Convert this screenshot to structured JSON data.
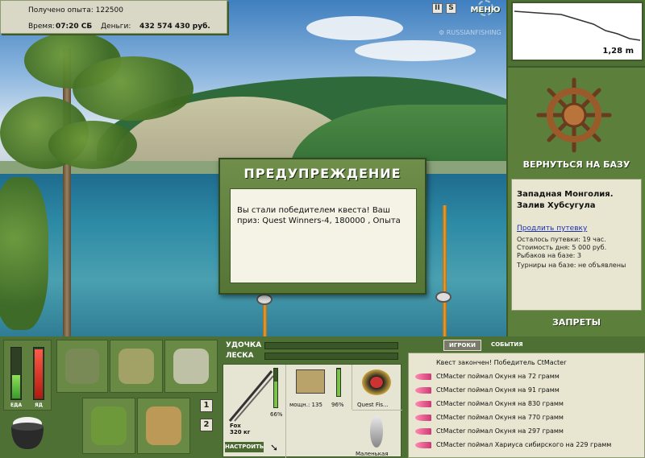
{
  "status": {
    "experience_label": "Получено опыта:",
    "experience_value": "122500",
    "time_label": "Время:",
    "time_value": "07:20 СБ",
    "money_label": "Деньги:",
    "money_value": "432 574 430 руб."
  },
  "top_controls": {
    "pause": "II",
    "sound": "S",
    "menu": "МЕНЮ"
  },
  "depth": {
    "value": "1,28 m"
  },
  "right_panel": {
    "back_to_base": "ВЕРНУТЬСЯ НА БАЗУ",
    "location_line1": "Западная Монголия.",
    "location_line2": "Залив Хубсугула",
    "extend_trip": "Продлить путевку",
    "trip_left": "Осталось путевки: 19 час.",
    "day_cost": "Стоимость дня: 5 000 руб.",
    "fishers": "Рыбаков на базе: 3",
    "tournaments": "Турниры на базе: не объявлены",
    "bans": "ЗАПРЕТЫ"
  },
  "dialog": {
    "title": "ПРЕДУПРЕЖДЕНИЕ",
    "message": "Вы стали победителем квеста! Ваш приз: Quest Winners-4, 180000 , Опыта"
  },
  "meters": {
    "food_label": "ЕДА",
    "poison_label": "ЯД",
    "food_level": 0.45,
    "poison_level": 0.95
  },
  "inventory": {
    "page1": "1",
    "page2": "2"
  },
  "tackle": {
    "rod_label": "УДОЧКА",
    "line_label": "ЛЕСКА",
    "rod_percent": "66%",
    "rod_name": "Fox",
    "rod_weight": "320 кг",
    "reel_power": "мощн.: 135",
    "reel_percent": "96%",
    "line_name": "Quest Fis...",
    "lure_name": "Маленькая",
    "tune_button": "НАСТРОИТЬ"
  },
  "chat": {
    "tab_players": "ИГРОКИ",
    "tab_events": "СОБЫТИЯ",
    "messages": [
      "Квест закончен! Победитель CtMacter",
      "CtMacter поймал Окуня на 72 грамм",
      "CtMacter поймал Окуня на 91 грамм",
      "CtMacter поймал Окуня на 830 грамм",
      "CtMacter поймал Окуня на 770 грамм",
      "CtMacter поймал Окуня на 297 грамм",
      "CtMacter поймал Хариуса сибирского на 229 грамм"
    ]
  }
}
